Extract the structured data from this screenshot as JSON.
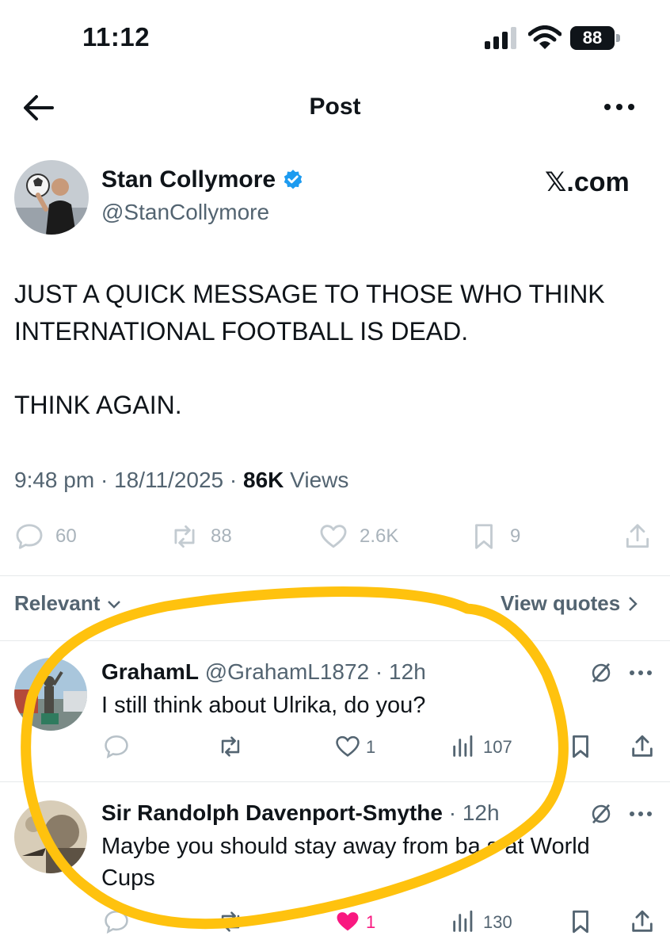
{
  "status_bar": {
    "time": "11:12",
    "battery": "88"
  },
  "header": {
    "title": "Post"
  },
  "author": {
    "name": "Stan Collymore",
    "handle": "@StanCollymore",
    "source": "𝕏.com"
  },
  "post": {
    "lines": [
      "JUST A QUICK MESSAGE TO THOSE WHO THINK INTERNATIONAL FOOTBALL IS DEAD.",
      "THINK AGAIN."
    ],
    "time": "9:48 pm",
    "date": "18/11/2025",
    "views_count": "86K",
    "views_label": "Views"
  },
  "actions": {
    "replies": "60",
    "reposts": "88",
    "likes": "2.6K",
    "bookmarks": "9"
  },
  "filter": {
    "sort_label": "Relevant",
    "view_quotes": "View quotes"
  },
  "replies": [
    {
      "name": "GrahamL",
      "handle": "@GrahamL1872",
      "age": "12h",
      "text": "I still think about Ulrika, do you?",
      "likes": "1",
      "views": "107"
    },
    {
      "name": "Sir Randolph Davenport-Smythe",
      "age": "12h",
      "text": "Maybe you should stay away from ba  s at World Cups",
      "likes": "1",
      "views": "130"
    }
  ],
  "colors": {
    "accent": "#1d9bf0",
    "muted": "#536471",
    "like": "#f91880",
    "marker": "#ffc20e"
  }
}
